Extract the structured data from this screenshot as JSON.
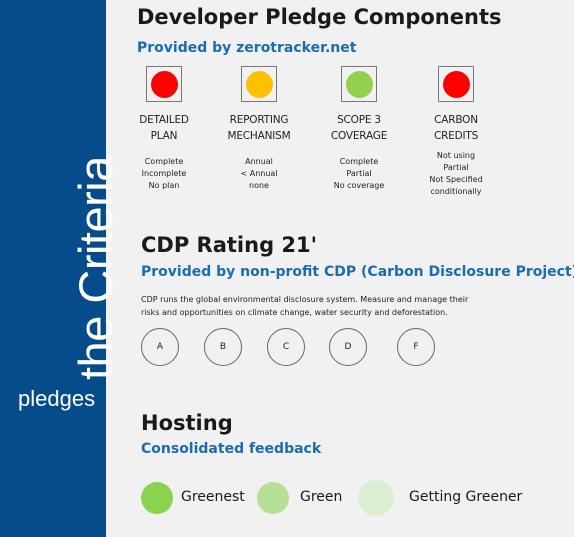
{
  "sidebar": {
    "title": "the Criteria",
    "subtitle": "pledges",
    "background": "#064c8b"
  },
  "pledge_section": {
    "title": "Developer Pledge Components",
    "source": "Provided by zerotracker.net",
    "components": [
      {
        "label_line1": "DETAILED",
        "label_line2": "PLAN",
        "status_color": "#ff0000",
        "status": "red",
        "options": [
          "Complete",
          "Incomplete",
          "No plan"
        ]
      },
      {
        "label_line1": "REPORTING",
        "label_line2": "MECHANISM",
        "status_color": "#ffc000",
        "status": "amber",
        "options": [
          "Annual",
          "< Annual",
          "none"
        ]
      },
      {
        "label_line1": "SCOPE 3",
        "label_line2": "COVERAGE",
        "status_color": "#92d050",
        "status": "green",
        "options": [
          "Complete",
          "Partial",
          "No coverage"
        ]
      },
      {
        "label_line1": "CARBON",
        "label_line2": "CREDITS",
        "status_color": "#ff0000",
        "status": "red",
        "options": [
          "Not using",
          "Partial",
          "Not Specified",
          "conditionally"
        ]
      }
    ]
  },
  "cdp_section": {
    "title": "CDP Rating 21'",
    "source": "Provided by non-profit CDP (Carbon Disclosure Project)",
    "description_line1": "CDP runs the global environmental disclosure system. Measure and manage their",
    "description_line2": "risks and opportunities on climate change, water security and deforestation.",
    "grades": [
      "A",
      "B",
      "C",
      "D",
      "F"
    ]
  },
  "hosting_section": {
    "title": "Hosting",
    "source": "Consolidated feedback",
    "levels": [
      {
        "label": "Greenest",
        "color": "#8ad34f"
      },
      {
        "label": "Green",
        "color": "#b6e095"
      },
      {
        "label": "Getting Greener",
        "color": "#dcedd1"
      }
    ]
  }
}
